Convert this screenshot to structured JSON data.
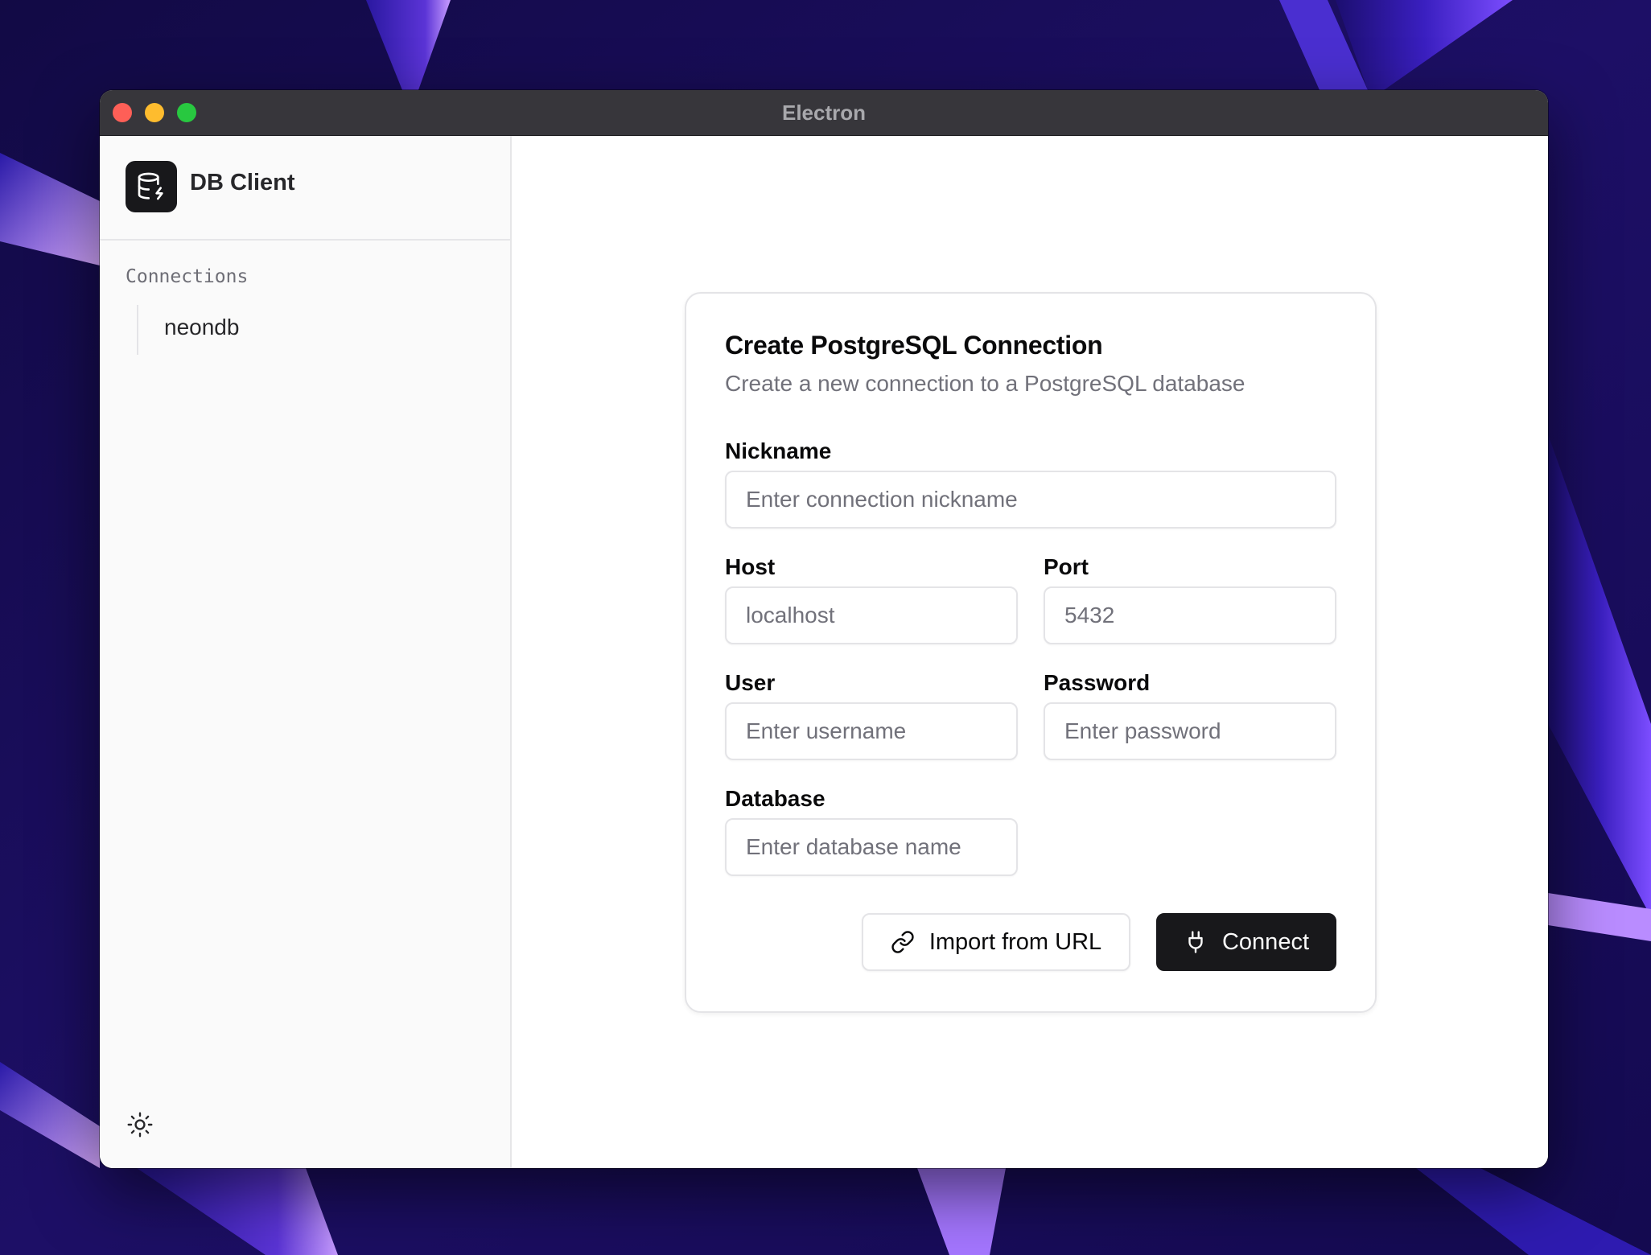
{
  "window": {
    "title": "Electron"
  },
  "sidebar": {
    "app_name": "DB Client",
    "section_label": "Connections",
    "connections": [
      {
        "name": "neondb"
      }
    ],
    "theme_icon": "sun-icon"
  },
  "form": {
    "title": "Create PostgreSQL Connection",
    "subtitle": "Create a new connection to a PostgreSQL database",
    "fields": {
      "nickname": {
        "label": "Nickname",
        "placeholder": "Enter connection nickname",
        "value": ""
      },
      "host": {
        "label": "Host",
        "placeholder": "localhost",
        "value": ""
      },
      "port": {
        "label": "Port",
        "placeholder": "5432",
        "value": ""
      },
      "user": {
        "label": "User",
        "placeholder": "Enter username",
        "value": ""
      },
      "password": {
        "label": "Password",
        "placeholder": "Enter password",
        "value": ""
      },
      "database": {
        "label": "Database",
        "placeholder": "Enter database name",
        "value": ""
      }
    },
    "import_button": {
      "label": "Import from URL",
      "icon": "link-icon"
    },
    "connect_button": {
      "label": "Connect",
      "icon": "plug-icon"
    }
  },
  "colors": {
    "primary_button": "#18181b",
    "border": "#e4e4e7",
    "muted_text": "#71717a",
    "sidebar_bg": "#fafafa",
    "titlebar_bg": "#37363b",
    "traffic_close": "#fe5f57",
    "traffic_minimize": "#febc2e",
    "traffic_zoom": "#28c840"
  }
}
